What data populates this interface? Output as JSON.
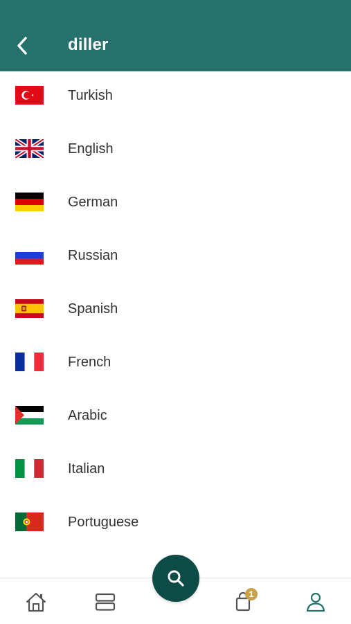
{
  "header": {
    "title": "diller",
    "back_icon": "chevron-left-icon",
    "background_color": "#26716b"
  },
  "languages": [
    {
      "label": "Turkish",
      "flag": "turkey-flag-icon"
    },
    {
      "label": "English",
      "flag": "uk-flag-icon"
    },
    {
      "label": "German",
      "flag": "germany-flag-icon"
    },
    {
      "label": "Russian",
      "flag": "russia-flag-icon"
    },
    {
      "label": "Spanish",
      "flag": "spain-flag-icon"
    },
    {
      "label": "French",
      "flag": "france-flag-icon"
    },
    {
      "label": "Arabic",
      "flag": "arabic-flag-icon"
    },
    {
      "label": "Italian",
      "flag": "italy-flag-icon"
    },
    {
      "label": "Portuguese",
      "flag": "portugal-flag-icon"
    }
  ],
  "bottom_nav": {
    "home_icon": "home-icon",
    "categories_icon": "list-icon",
    "search_icon": "search-icon",
    "cart_icon": "shopping-bag-icon",
    "profile_icon": "user-icon",
    "cart_count": "1",
    "badge_color": "#c9a24a",
    "active_color": "#26716b",
    "fab_color": "#0d4b47"
  }
}
